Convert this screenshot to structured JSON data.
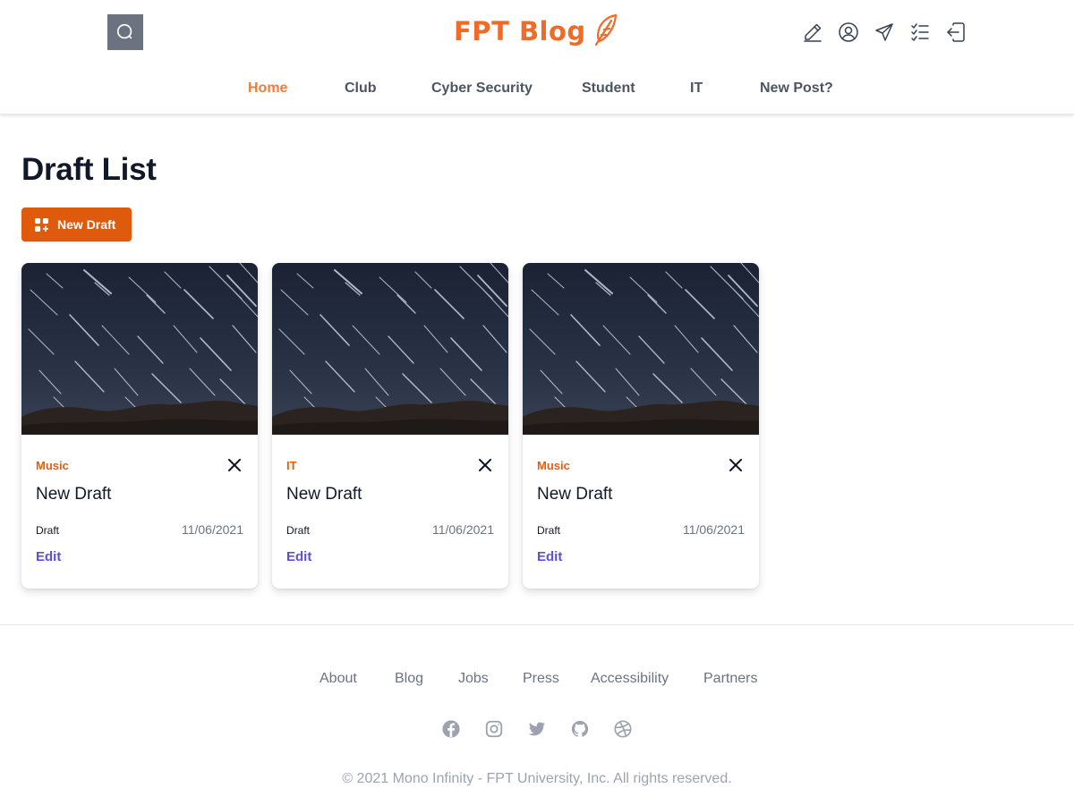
{
  "header": {
    "logo_text": "FPT Blog",
    "brand_color": "#f06a28",
    "icons": [
      "search-icon",
      "pencil-icon",
      "user-circle-icon",
      "send-icon",
      "checklist-icon",
      "logout-icon"
    ]
  },
  "nav": {
    "items": [
      {
        "label": "Home",
        "active": true
      },
      {
        "label": "Club",
        "active": false
      },
      {
        "label": "Cyber Security",
        "active": false
      },
      {
        "label": "Student",
        "active": false
      },
      {
        "label": "IT",
        "active": false
      },
      {
        "label": "New Post?",
        "active": false
      }
    ]
  },
  "main": {
    "title": "Draft List",
    "new_draft_label": "New Draft"
  },
  "cards": [
    {
      "category": "Music",
      "title": "New Draft",
      "status": "Draft",
      "date": "11/06/2021",
      "edit_label": "Edit"
    },
    {
      "category": "IT",
      "title": "New Draft",
      "status": "Draft",
      "date": "11/06/2021",
      "edit_label": "Edit"
    },
    {
      "category": "Music",
      "title": "New Draft",
      "status": "Draft",
      "date": "11/06/2021",
      "edit_label": "Edit"
    }
  ],
  "footer": {
    "links": [
      "About",
      "Blog",
      "Jobs",
      "Press",
      "Accessibility",
      "Partners"
    ],
    "social_icons": [
      "facebook-icon",
      "instagram-icon",
      "twitter-icon",
      "github-icon",
      "dribbble-icon"
    ],
    "copyright": "© 2021 Mono Infinity - FPT University, Inc. All rights reserved."
  },
  "colors": {
    "accent": "#de5a0c",
    "nav_active": "#f47b35",
    "edit_link": "#5b4fe0"
  }
}
